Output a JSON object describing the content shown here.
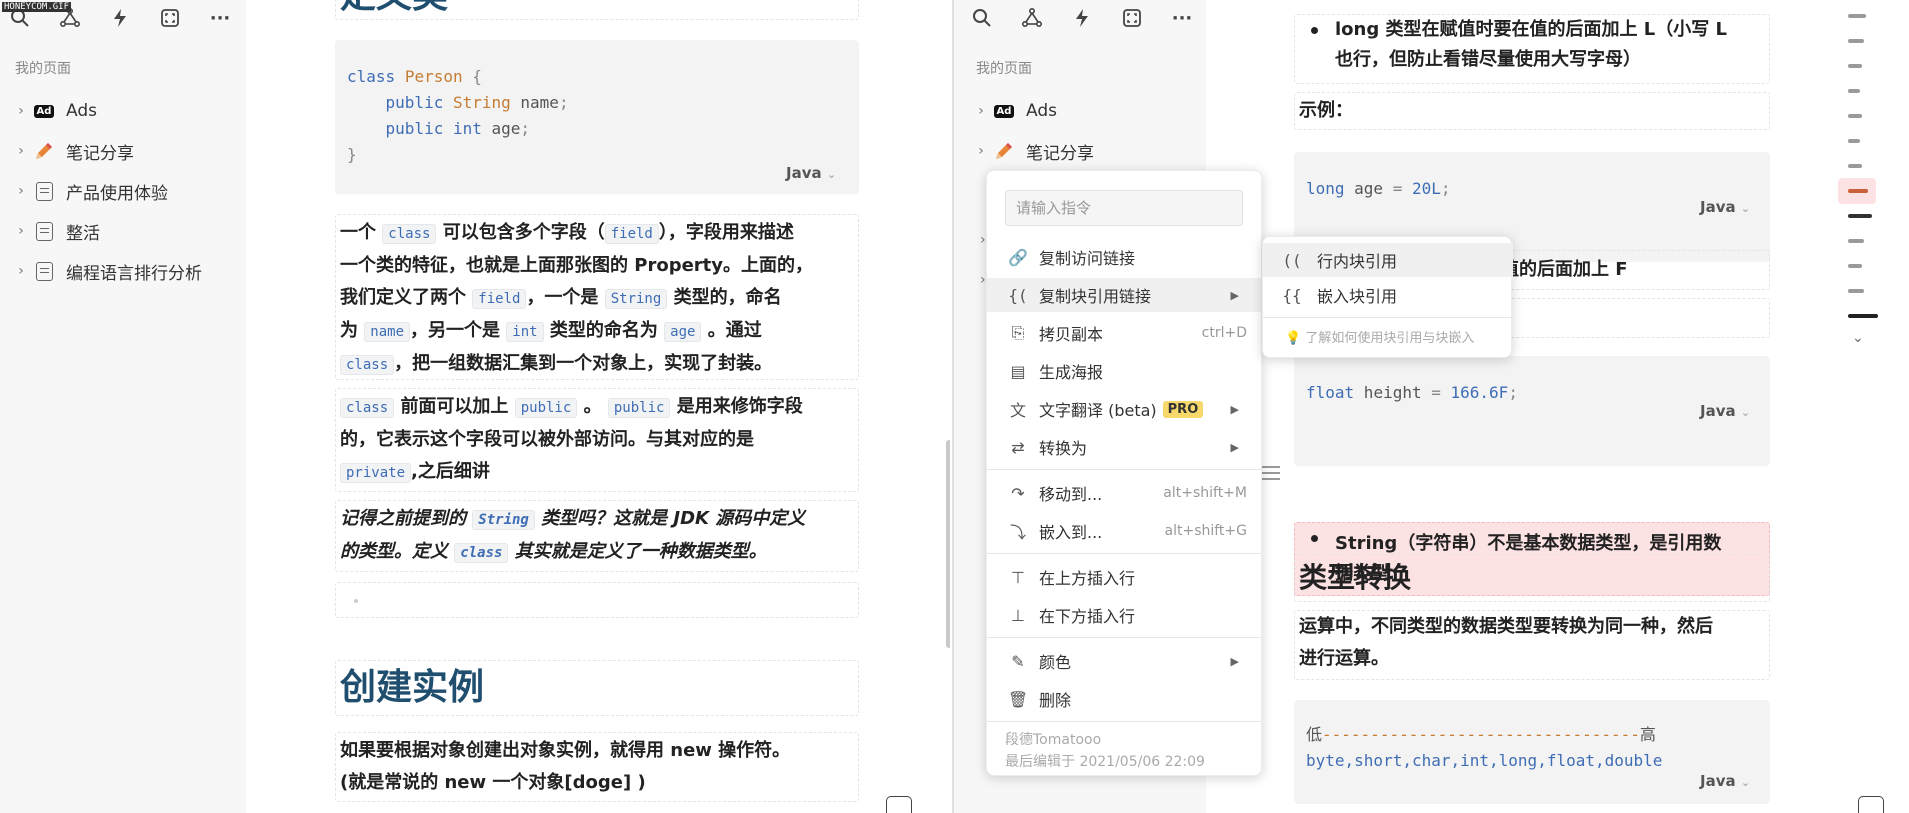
{
  "watermark": "HONEYCOM.GIF",
  "sidebar": {
    "heading": "我的页面",
    "items": [
      {
        "label": "Ads",
        "icon": "ad-icon"
      },
      {
        "label": "笔记分享",
        "icon": "pencil-icon"
      },
      {
        "label": "产品使用体验",
        "icon": "document-icon"
      },
      {
        "label": "整活",
        "icon": "document-icon"
      },
      {
        "label": "编程语言排行分析",
        "icon": "document-icon"
      }
    ]
  },
  "left_doc": {
    "heading_top": "定义类",
    "code1": {
      "lang": "Java"
    },
    "p1": {
      "t1": "一个",
      "c1": "class",
      "t2": "可以包含多个字段（",
      "c2": "field",
      "t3": "），字段用来描述",
      "t4": "一个类的特征，也就是上面那张图的 Property。上面的，",
      "t5": "我们定义了两个",
      "c3": "field",
      "t6": "，一个是",
      "c4": "String",
      "t7": "类型的，命名",
      "t8": "为",
      "c5": "name",
      "t9": "，另一个是",
      "c6": "int",
      "t10": "类型的命名为",
      "c7": "age",
      "t11": "。通过",
      "c8": "class",
      "t12": "，把一组数据汇集到一个对象上，实现了封装。"
    },
    "p2": {
      "c1": "class",
      "t1": "前面可以加上",
      "c2": "public",
      "t2": "。",
      "c3": "public",
      "t3": "是用来修饰字段",
      "t4": "的，它表示这个字段可以被外部访问。与其对应的是",
      "c4": "private",
      "t5": ",之后细讲"
    },
    "p3": {
      "t1": "记得之前提到的",
      "c1": "String",
      "t2": "类型吗？这就是 JDK 源码中定义",
      "t3": "的类型。定义",
      "c2": "class",
      "t4": "其实就是定义了一种数据类型。"
    },
    "heading2": "创建实例",
    "p4": {
      "t1": "如果要根据对象创建出对象实例，就得用 new 操作符。",
      "t2": "(就是常说的 new 一个对象[doge] )"
    }
  },
  "right_doc": {
    "b1": {
      "l1": "long 类型在赋值时要在值的后面加上 L（小写 L",
      "l2": "也行，但防止看错尽量使用大写字母）"
    },
    "example_label": "示例：",
    "code1": {
      "lang": "Java"
    },
    "partial_text": "要在值的后面加上 F",
    "code2": {
      "lang": "Java"
    },
    "b2": {
      "l1": "String（字符串）不是基本数据类型，是引用数",
      "l2": "据类型"
    },
    "heading3": "类型转换",
    "p1": {
      "l1": "运算中，不同类型的数据类型要转换为同一种，然后",
      "l2": "进行运算。"
    },
    "code3": {
      "lang": "Java"
    }
  },
  "context_menu": {
    "search_placeholder": "请输入指令",
    "items": [
      {
        "label": "复制访问链接",
        "icon": "link-icon",
        "shortcut": ""
      },
      {
        "label": "复制块引用链接",
        "icon": "block-ref-icon",
        "shortcut": ""
      },
      {
        "label": "拷贝副本",
        "icon": "copy-icon",
        "shortcut": "ctrl+D"
      },
      {
        "label": "生成海报",
        "icon": "poster-icon",
        "shortcut": ""
      },
      {
        "label": "文字翻译 (beta)",
        "icon": "translate-icon",
        "shortcut": "",
        "badge": "PRO"
      },
      {
        "label": "转换为",
        "icon": "convert-icon",
        "shortcut": ""
      },
      {
        "label": "移动到...",
        "icon": "move-icon",
        "shortcut": "alt+shift+M"
      },
      {
        "label": "嵌入到...",
        "icon": "embed-icon",
        "shortcut": "alt+shift+G"
      },
      {
        "label": "在上方插入行",
        "icon": "insert-above-icon",
        "shortcut": ""
      },
      {
        "label": "在下方插入行",
        "icon": "insert-below-icon",
        "shortcut": ""
      },
      {
        "label": "颜色",
        "icon": "color-icon",
        "shortcut": ""
      },
      {
        "label": "删除",
        "icon": "trash-icon",
        "shortcut": ""
      }
    ],
    "footer_author": "段德Tomatooo",
    "footer_edited": "最后编辑于 2021/05/06 22:09"
  },
  "submenu": {
    "items": [
      {
        "label": "行内块引用",
        "icon": "inline-ref-icon"
      },
      {
        "label": "嵌入块引用",
        "icon": "embed-ref-icon"
      }
    ],
    "hint": "了解如何使用块引用与块嵌入"
  },
  "colors": {
    "accent": "#1f4e6e",
    "code_keyword": "#3f6db5",
    "code_type": "#c67c33",
    "highlight_red": "#fde2e4",
    "pro_badge": "#f6d86b"
  }
}
